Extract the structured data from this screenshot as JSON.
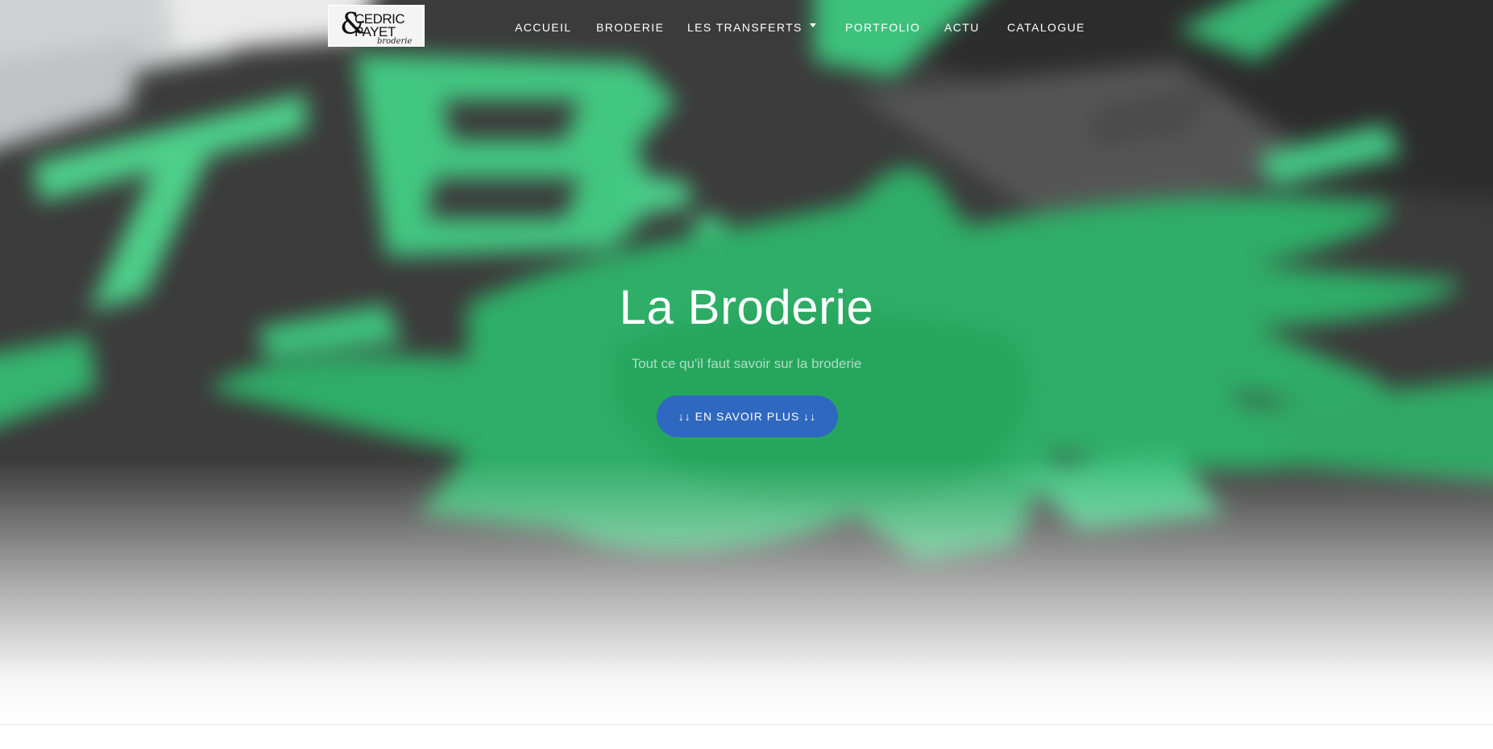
{
  "brand": {
    "mark": "&",
    "line1": "CEDRIC",
    "line2": "PAYET",
    "line3": "broderie"
  },
  "nav": {
    "items": [
      {
        "label": "ACCUEIL"
      },
      {
        "label": "BRODERIE"
      },
      {
        "label": "LES TRANSFERTS"
      },
      {
        "label": "PORTFOLIO"
      },
      {
        "label": "ACTU"
      },
      {
        "label": "CATALOGUE"
      }
    ],
    "dropdown_icon": "caret-down-icon"
  },
  "hero": {
    "title": "La Broderie",
    "subtitle": "Tout ce qu'il faut savoir sur la broderie",
    "cta_label": "↓↓ EN SAVOIR PLUS ↓↓",
    "image": "blurred-green-embroidery-on-dark-fabric"
  },
  "colors": {
    "accent": "#2f68c1",
    "embroidery_green": "#3fc57c",
    "fabric_dark": "#3a3a3a"
  }
}
